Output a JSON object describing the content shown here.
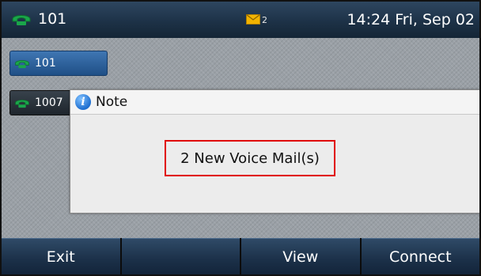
{
  "status_bar": {
    "account_label": "101",
    "account_icon": "phone-handset-icon",
    "voicemail_icon": "envelope-icon",
    "voicemail_count": "2",
    "datetime": "14:24 Fri, Sep 02"
  },
  "line_keys": [
    {
      "label": "101",
      "icon": "phone-handset-icon",
      "active": true
    },
    {
      "label": "1007",
      "icon": "phone-handset-icon",
      "active": false
    }
  ],
  "dialog": {
    "icon": "info-icon",
    "title": "Note",
    "message": "2 New Voice Mail(s)",
    "highlight_color": "#e00000"
  },
  "softkeys": [
    {
      "label": "Exit"
    },
    {
      "label": ""
    },
    {
      "label": "View"
    },
    {
      "label": "Connect"
    }
  ],
  "colors": {
    "accent_blue": "#1f4f86",
    "handset_green": "#1aa64a",
    "softkey_bg": "#1b3048"
  }
}
